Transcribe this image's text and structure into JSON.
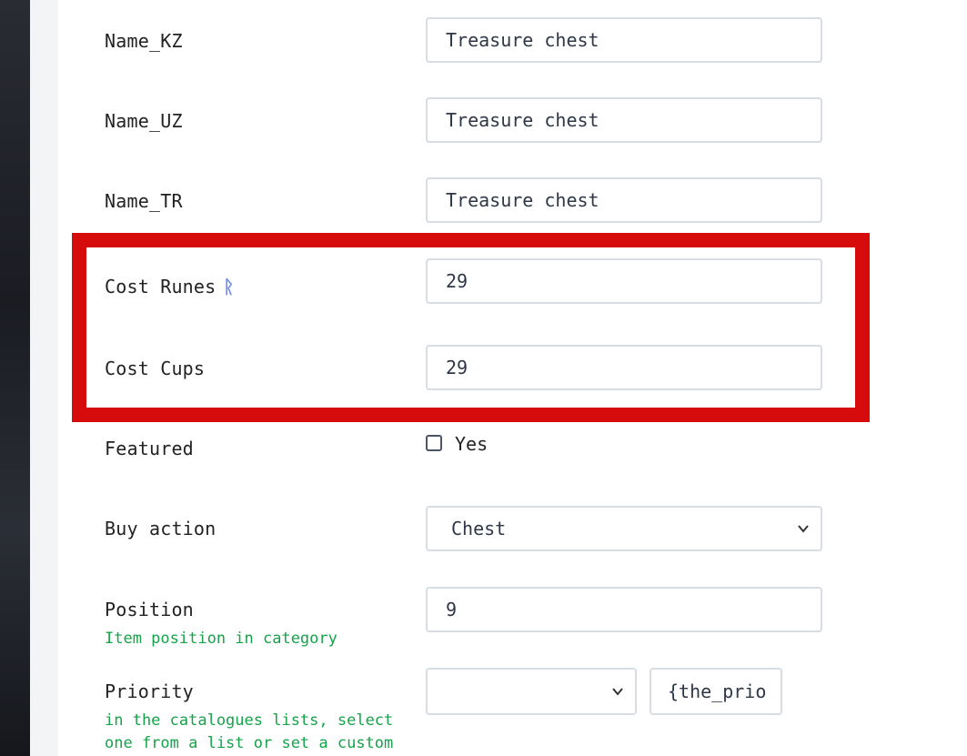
{
  "fields": {
    "name_kz": {
      "label": "Name_KZ",
      "value": "Treasure chest"
    },
    "name_uz": {
      "label": "Name_UZ",
      "value": "Treasure chest"
    },
    "name_tr": {
      "label": "Name_TR",
      "value": "Treasure chest"
    },
    "cost_runes": {
      "label": "Cost Runes",
      "icon": "rune-icon",
      "icon_glyph": "ᚱ",
      "value": "29"
    },
    "cost_cups": {
      "label": "Cost Cups",
      "value": "29"
    },
    "featured": {
      "label": "Featured",
      "checkbox_label": "Yes",
      "checked": false
    },
    "buy_action": {
      "label": "Buy action",
      "selected": "Chest"
    },
    "position": {
      "label": "Position",
      "help": "Item position in category",
      "value": "9"
    },
    "priority": {
      "label": "Priority",
      "help_line1": "in the catalogues lists, select",
      "help_line2": "one from a list or set a custom",
      "selected": "",
      "custom_value": "{the_prio"
    }
  },
  "colors": {
    "highlight": "#d60b0b",
    "help_text": "#16a34a",
    "rune_icon": "#6b8be6"
  }
}
